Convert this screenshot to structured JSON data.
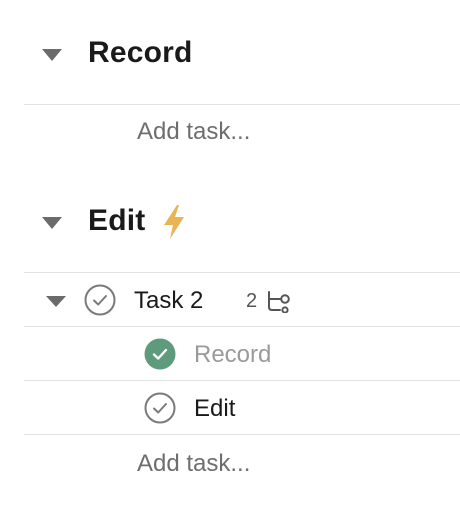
{
  "sections": [
    {
      "title": "Record",
      "add_task_label": "Add task..."
    },
    {
      "title": "Edit",
      "title_icon": "lightning-bolt-icon",
      "add_task_label": "Add task...",
      "tasks": [
        {
          "name": "Task 2",
          "completed": false,
          "subtask_count": "2",
          "subtask_icon": "subtasks-icon",
          "subtasks": [
            {
              "name": "Record",
              "completed": true
            },
            {
              "name": "Edit",
              "completed": false
            }
          ]
        }
      ]
    }
  ],
  "colors": {
    "bolt": "#E8B455",
    "completed_check": "#5E9A7C",
    "caret": "#6B6B6B",
    "divider": "#E2E2E2",
    "muted_text": "#6E6E6E"
  }
}
